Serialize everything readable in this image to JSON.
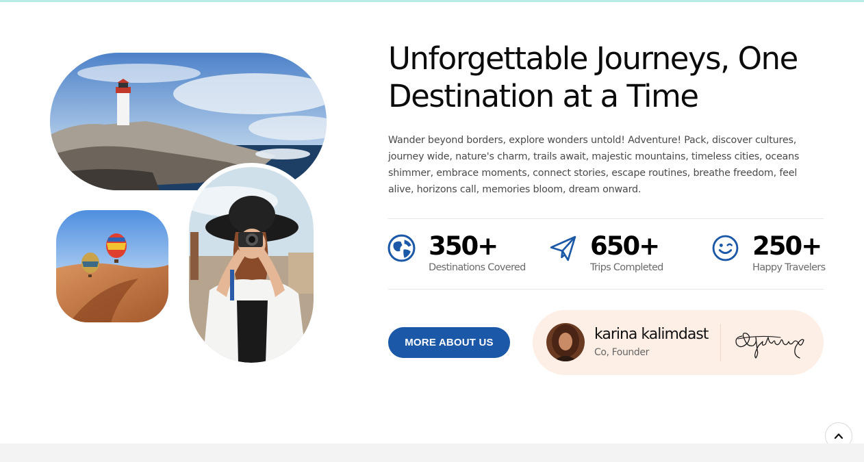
{
  "section": {
    "title": "Unforgettable Journeys, One Destination at a Time",
    "description": "Wander beyond borders, explore wonders untold! Adventure! Pack, discover cultures, journey wide, nature's charm, trails await, majestic mountains, timeless cities, oceans shimmer, embrace moments, connect stories, escape routines, breathe freedom, feel alive, horizons call, memories bloom, dream onward."
  },
  "stats": [
    {
      "value": "350+",
      "label": "Destinations Covered",
      "icon": "globe-icon"
    },
    {
      "value": "650+",
      "label": "Trips Completed",
      "icon": "paper-plane-icon"
    },
    {
      "value": "250+",
      "label": "Happy Travelers",
      "icon": "smiley-icon"
    }
  ],
  "cta": {
    "label": "MORE ABOUT US"
  },
  "founder": {
    "name": "karina kalimdast",
    "role": "Co, Founder"
  },
  "images": {
    "lighthouse": "lighthouse-photo",
    "balloons": "hot-air-balloons-photo",
    "photographer": "woman-with-camera-photo",
    "avatar": "founder-avatar-photo"
  },
  "colors": {
    "accent": "#1c58a8",
    "founder_card": "#fdefe6",
    "top_line": "#b9ece6"
  }
}
